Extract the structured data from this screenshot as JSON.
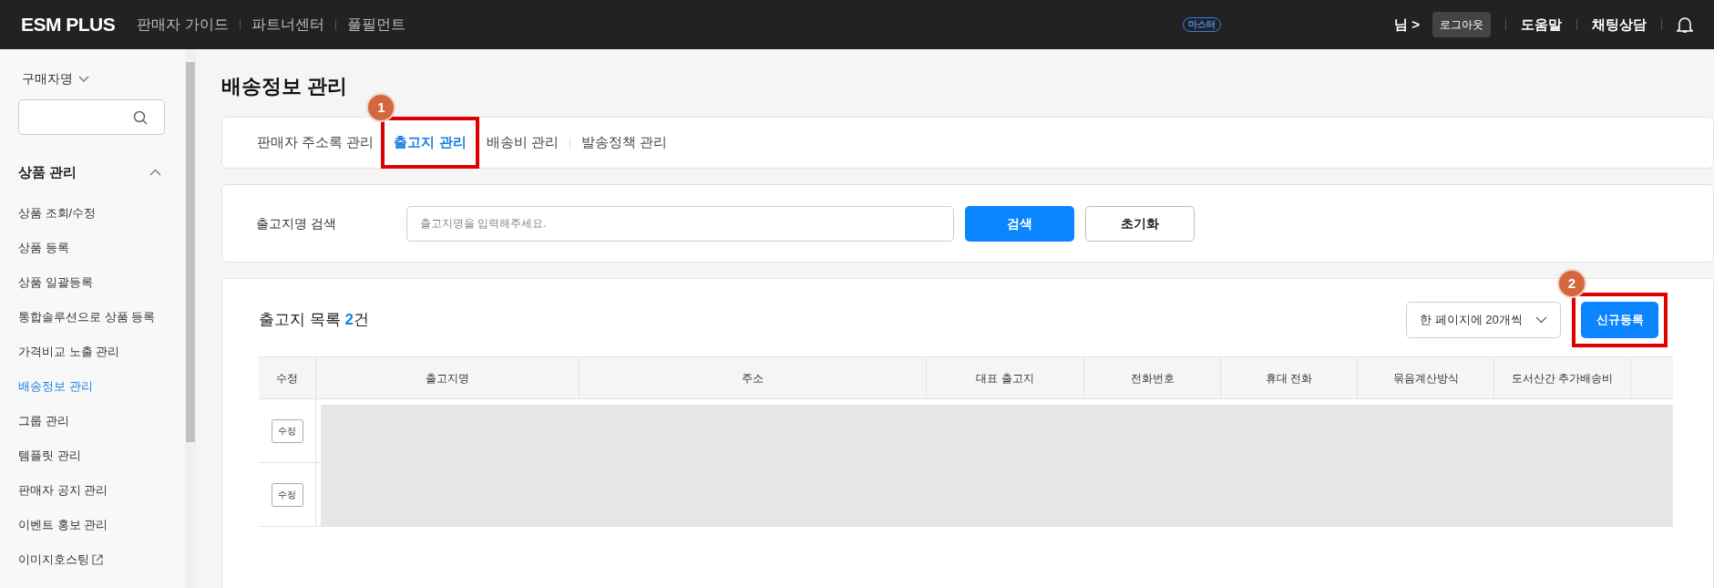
{
  "topbar": {
    "logo": "ESM PLUS",
    "links": [
      "판매자 가이드",
      "파트너센터",
      "풀필먼트"
    ],
    "badge": "마스터",
    "user": "님 >",
    "logout": "로그아웃",
    "right_links": [
      "도움말",
      "채팅상담"
    ]
  },
  "sidebar": {
    "search_type": "구매자명",
    "section": {
      "title": "상품 관리",
      "expanded": true,
      "items": [
        {
          "label": "상품 조회/수정",
          "selected": false,
          "external": false
        },
        {
          "label": "상품 등록",
          "selected": false,
          "external": false
        },
        {
          "label": "상품 일괄등록",
          "selected": false,
          "external": false
        },
        {
          "label": "통합솔루션으로 상품 등록",
          "selected": false,
          "external": false
        },
        {
          "label": "가격비교 노출 관리",
          "selected": false,
          "external": false
        },
        {
          "label": "배송정보 관리",
          "selected": true,
          "external": false
        },
        {
          "label": "그룹 관리",
          "selected": false,
          "external": false
        },
        {
          "label": "템플릿 관리",
          "selected": false,
          "external": false
        },
        {
          "label": "판매자 공지 관리",
          "selected": false,
          "external": false
        },
        {
          "label": "이벤트 홍보 관리",
          "selected": false,
          "external": false
        },
        {
          "label": "이미지호스팅",
          "selected": false,
          "external": true
        }
      ]
    }
  },
  "page_title": "배송정보 관리",
  "tabs": [
    {
      "label": "판매자 주소록 관리",
      "selected": false
    },
    {
      "label": "출고지 관리",
      "selected": true,
      "annotation": "1"
    },
    {
      "label": "배송비 관리",
      "selected": false
    },
    {
      "label": "발송정책 관리",
      "selected": false
    }
  ],
  "search": {
    "label": "출고지명 검색",
    "placeholder": "출고지명을 입력해주세요.",
    "buttons": [
      "검색",
      "초기화"
    ]
  },
  "list": {
    "title": "출고지 목록",
    "count": "2",
    "count_suffix": "건",
    "page_size": "한 페이지에 20개씩",
    "new_button": "신규등록",
    "new_annotation": "2",
    "columns": [
      "수정",
      "출고지명",
      "주소",
      "대표 출고지",
      "전화번호",
      "휴대 전화",
      "묶음계산방식",
      "도서산간 추가배송비"
    ],
    "rows": [
      {
        "edit": "수정"
      },
      {
        "edit": "수정"
      }
    ]
  }
}
